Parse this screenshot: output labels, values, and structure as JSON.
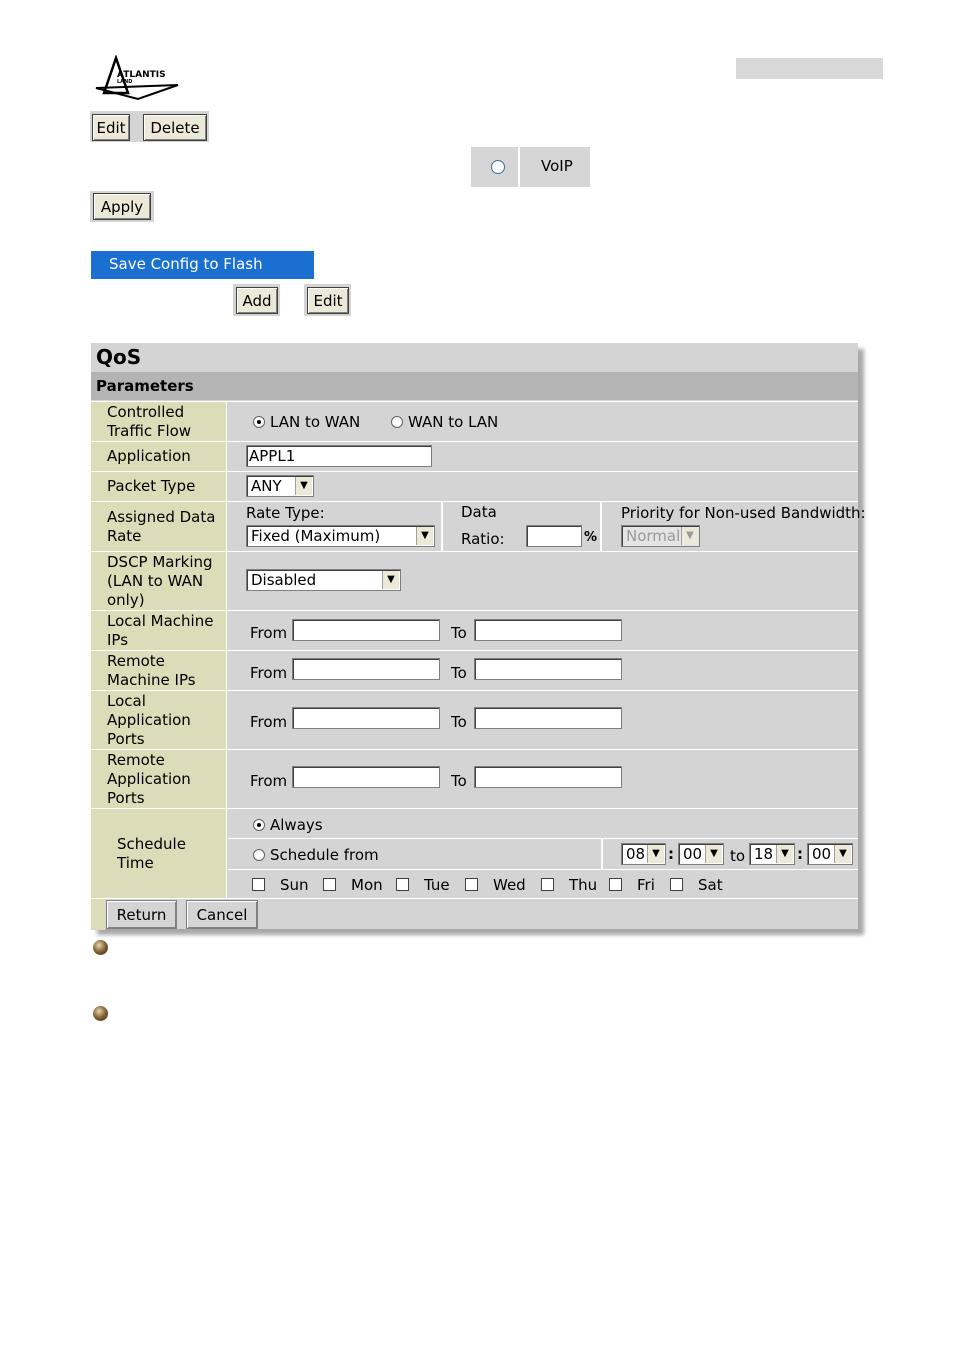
{
  "header": {
    "logo_text": "ATLANTIS LAND"
  },
  "top_buttons": {
    "edit": "Edit",
    "delete": "Delete"
  },
  "voip": {
    "label": "VoIP"
  },
  "apply_button": "Apply",
  "save_config": "Save Config to Flash",
  "add_edit": {
    "add": "Add",
    "edit": "Edit"
  },
  "qos": {
    "title": "QoS",
    "section": "Parameters",
    "rows": {
      "traffic_flow": {
        "label": "Controlled Traffic Flow",
        "opt1": "LAN to WAN",
        "opt2": "WAN to LAN",
        "selected": "LAN to WAN"
      },
      "application": {
        "label": "Application",
        "value": "APPL1"
      },
      "packet_type": {
        "label": "Packet Type",
        "value": "ANY"
      },
      "data_rate": {
        "label": "Assigned Data Rate",
        "rate_type_label": "Rate Type:",
        "rate_type_value": "Fixed (Maximum)",
        "data_label": "Data",
        "ratio_label": "Ratio:",
        "ratio_value": "",
        "percent": "%",
        "priority_label": "Priority for Non-used Bandwidth:",
        "priority_value": "Normal"
      },
      "dscp": {
        "label": "DSCP Marking (LAN to WAN only)",
        "value": "Disabled"
      },
      "local_ips": {
        "label": "Local Machine IPs",
        "from": "From",
        "to": "To"
      },
      "remote_ips": {
        "label": "Remote Machine IPs",
        "from": "From",
        "to": "To"
      },
      "local_ports": {
        "label": "Local Application Ports",
        "from": "From",
        "to": "To"
      },
      "remote_ports": {
        "label": "Remote Application Ports",
        "from": "From",
        "to": "To"
      },
      "schedule": {
        "label": "Schedule Time",
        "always": "Always",
        "from": "Schedule from",
        "start_hour": "08",
        "start_min": "00",
        "to": "to",
        "end_hour": "18",
        "end_min": "00",
        "colon": ":",
        "days": [
          "Sun",
          "Mon",
          "Tue",
          "Wed",
          "Thu",
          "Fri",
          "Sat"
        ]
      }
    },
    "buttons": {
      "return": "Return",
      "cancel": "Cancel"
    }
  },
  "colors": {
    "label_bg": "#dcdcb8",
    "panel_bg": "#d4d4d4",
    "header_bg": "#b4b4b4",
    "flash_blue": "#1a6fd1"
  }
}
